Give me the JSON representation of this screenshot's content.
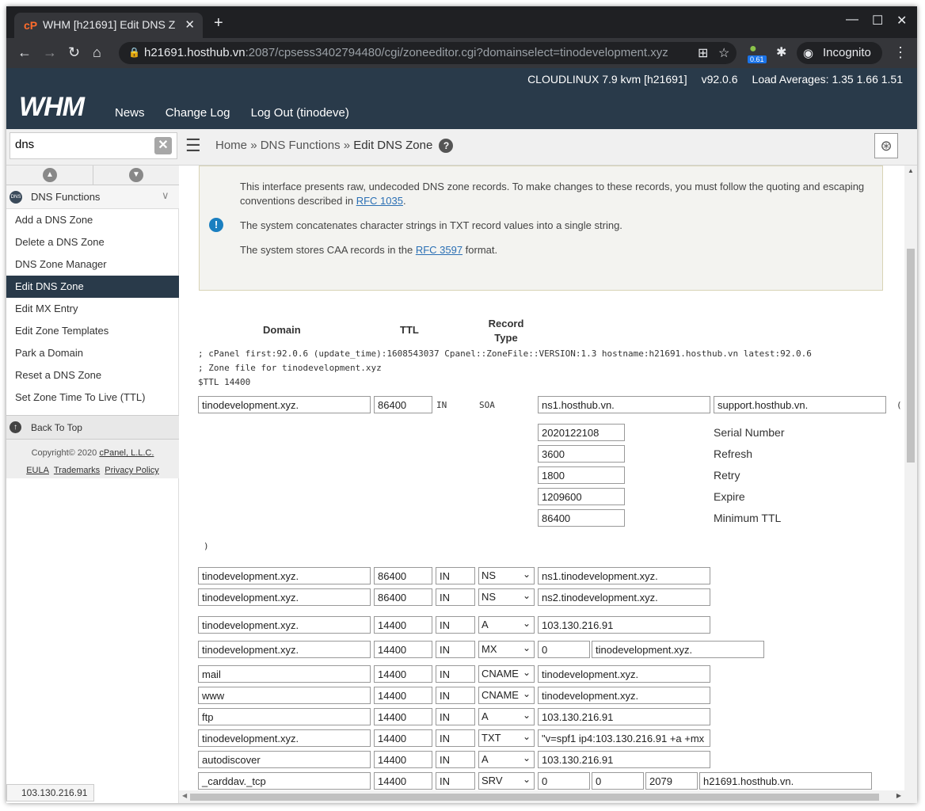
{
  "browser": {
    "tab_title": "WHM [h21691] Edit DNS Z",
    "url_host": "h21691.hosthub.vn",
    "url_rest": ":2087/cpsess3402794480/cgi/zoneeditor.cgi?domainselect=tinodevelopment.xyz",
    "extension_badge": "0.61",
    "incognito_label": "Incognito"
  },
  "header": {
    "os": "CLOUDLINUX 7.9 kvm [h21691]",
    "version": "v92.0.6",
    "load": "Load Averages: 1.35 1.66 1.51",
    "logo": "WHM",
    "nav": [
      "News",
      "Change Log",
      "Log Out (tinodeve)"
    ]
  },
  "search": {
    "value": "dns"
  },
  "breadcrumb": {
    "home": "Home",
    "sep": "»",
    "section": "DNS Functions",
    "current": "Edit DNS Zone"
  },
  "sidebar": {
    "category": "DNS Functions",
    "items": [
      {
        "label": "Add a DNS Zone"
      },
      {
        "label": "Delete a DNS Zone"
      },
      {
        "label": "DNS Zone Manager"
      },
      {
        "label": "Edit DNS Zone"
      },
      {
        "label": "Edit MX Entry"
      },
      {
        "label": "Edit Zone Templates"
      },
      {
        "label": "Park a Domain"
      },
      {
        "label": "Reset a DNS Zone"
      },
      {
        "label": "Set Zone Time To Live (TTL)"
      }
    ],
    "back_to_top": "Back To Top",
    "copyright_prefix": "Copyright© 2020 ",
    "copyright_link": "cPanel, L.L.C.",
    "footer_links": [
      "EULA",
      "Trademarks",
      "Privacy Policy"
    ]
  },
  "notice": {
    "p1_text": "This interface presents raw, undecoded DNS zone records. To make changes to these records, you must follow the quoting and escaping conventions described in ",
    "p1_link": "RFC 1035",
    "p2": "The system concatenates character strings in TXT record values into a single string.",
    "p3_text": "The system stores CAA records in the ",
    "p3_link": "RFC 3597",
    "p3_end": " format."
  },
  "columns": {
    "domain": "Domain",
    "ttl": "TTL",
    "record_type": "Record Type"
  },
  "zone_comments": [
    "; cPanel first:92.0.6 (update_time):1608543037 Cpanel::ZoneFile::VERSION:1.3 hostname:h21691.hosthub.vn latest:92.0.6",
    "; Zone file for tinodevelopment.xyz",
    "$TTL 14400"
  ],
  "soa": {
    "domain": "tinodevelopment.xyz.",
    "ttl": "86400",
    "class": "IN",
    "type": "SOA",
    "mname": "ns1.hosthub.vn.",
    "rname": "support.hosthub.vn.",
    "paren_open": "(",
    "paren_close": ")",
    "fields": [
      {
        "value": "2020122108",
        "label": "Serial Number"
      },
      {
        "value": "3600",
        "label": "Refresh"
      },
      {
        "value": "1800",
        "label": "Retry"
      },
      {
        "value": "1209600",
        "label": "Expire"
      },
      {
        "value": "86400",
        "label": "Minimum TTL"
      }
    ]
  },
  "records": [
    {
      "name": "tinodevelopment.xyz.",
      "ttl": "86400",
      "class": "IN",
      "type": "NS",
      "data": [
        "ns1.tinodevelopment.xyz."
      ]
    },
    {
      "name": "tinodevelopment.xyz.",
      "ttl": "86400",
      "class": "IN",
      "type": "NS",
      "data": [
        "ns2.tinodevelopment.xyz."
      ]
    },
    {
      "name": "tinodevelopment.xyz.",
      "ttl": "14400",
      "class": "IN",
      "type": "A",
      "data": [
        "103.130.216.91"
      ]
    },
    {
      "name": "tinodevelopment.xyz.",
      "ttl": "14400",
      "class": "IN",
      "type": "MX",
      "data": [
        "0",
        "tinodevelopment.xyz."
      ]
    },
    {
      "name": "mail",
      "ttl": "14400",
      "class": "IN",
      "type": "CNAME",
      "data": [
        "tinodevelopment.xyz."
      ]
    },
    {
      "name": "www",
      "ttl": "14400",
      "class": "IN",
      "type": "CNAME",
      "data": [
        "tinodevelopment.xyz."
      ]
    },
    {
      "name": "ftp",
      "ttl": "14400",
      "class": "IN",
      "type": "A",
      "data": [
        "103.130.216.91"
      ]
    },
    {
      "name": "tinodevelopment.xyz.",
      "ttl": "14400",
      "class": "IN",
      "type": "TXT",
      "data": [
        "\"v=spf1 ip4:103.130.216.91 +a +mx"
      ]
    },
    {
      "name": "autodiscover",
      "ttl": "14400",
      "class": "IN",
      "type": "A",
      "data": [
        "103.130.216.91"
      ]
    },
    {
      "name": "_carddav._tcp",
      "ttl": "14400",
      "class": "IN",
      "type": "SRV",
      "data": [
        "0",
        "0",
        "2079",
        "h21691.hosthub.vn."
      ]
    }
  ],
  "status_url": "103.130.216.91",
  "colors": {
    "header_bg": "#293a4a",
    "chrome_dark": "#35363a",
    "link": "#2a6fb4",
    "info": "#1a7fc0"
  }
}
